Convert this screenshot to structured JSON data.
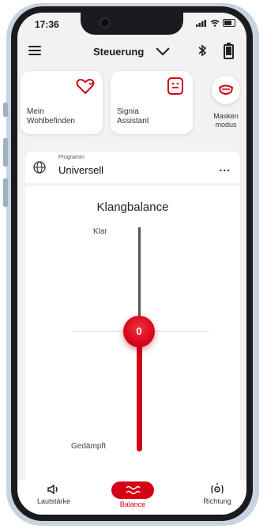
{
  "status_bar": {
    "time": "17:36"
  },
  "header": {
    "title": "Steuerung"
  },
  "cards": [
    {
      "label_line1": "Mein",
      "label_line2": "Wohlbefinden",
      "icon": "heart-icon"
    },
    {
      "label_line1": "Signia",
      "label_line2": "Assistant",
      "icon": "assistant-face-icon"
    }
  ],
  "mask_mode": {
    "label_line1": "Masken",
    "label_line2": "modus",
    "icon": "mask-icon"
  },
  "program": {
    "caption": "Programm",
    "name": "Universell",
    "more": "..."
  },
  "balance": {
    "title": "Klangbalance",
    "top_label": "Klar",
    "bottom_label": "Gedämpft",
    "value": "0",
    "level": 0
  },
  "nav": [
    {
      "label": "Lautstärke",
      "icon": "speaker-icon",
      "active": false
    },
    {
      "label": "Balance",
      "icon": "wave-icon",
      "active": true
    },
    {
      "label": "Richtung",
      "icon": "direction-icon",
      "active": false
    }
  ],
  "colors": {
    "accent": "#d40015",
    "background": "#f2f2f2",
    "card": "#ffffff"
  }
}
